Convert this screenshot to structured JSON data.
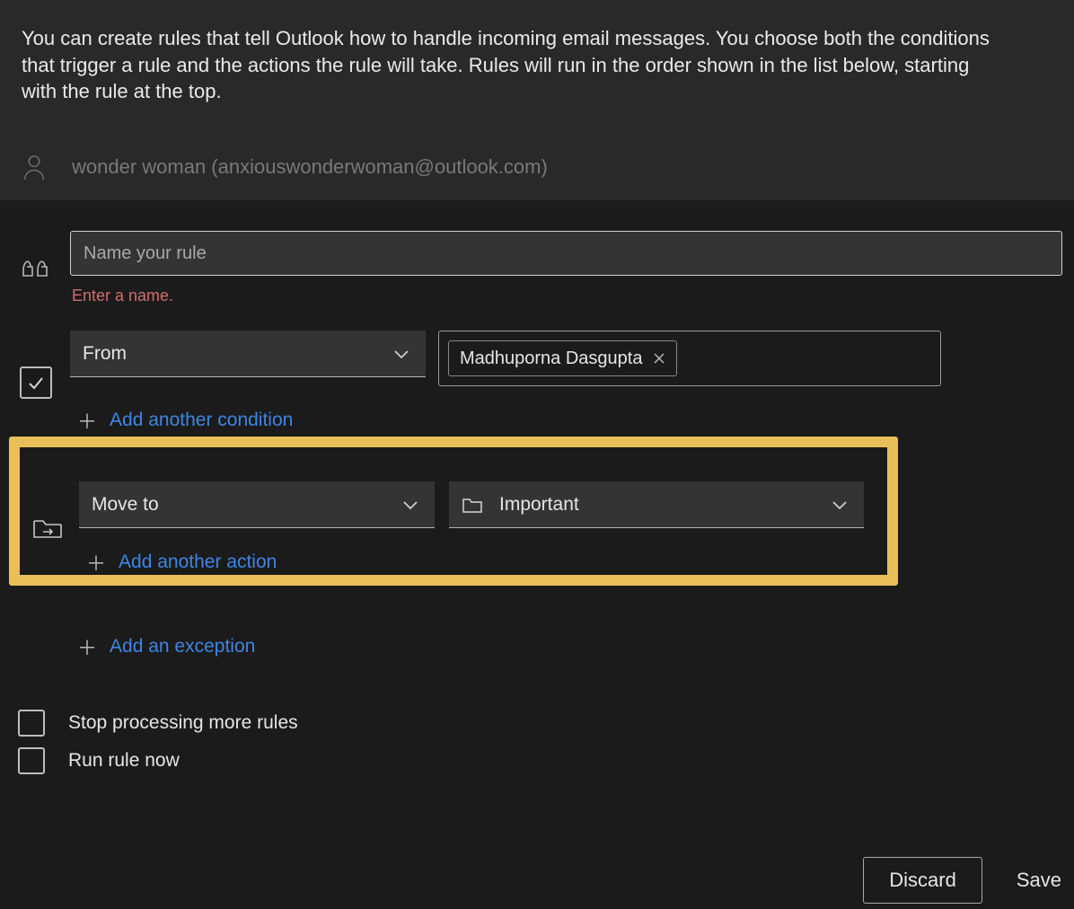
{
  "intro": "You can create rules that tell Outlook how to handle incoming email messages. You choose both the conditions that trigger a rule and the actions the rule will take. Rules will run in the order shown in the list below, starting with the rule at the top.",
  "account": {
    "display": "wonder woman (anxiouswonderwoman@outlook.com)"
  },
  "rule_name": {
    "placeholder": "Name your rule",
    "value": "",
    "error": "Enter a name."
  },
  "condition": {
    "type_label": "From",
    "chip_name": "Madhuporna Dasgupta",
    "add_link": "Add another condition"
  },
  "action": {
    "type_label": "Move to",
    "folder_label": "Important",
    "add_link": "Add another action"
  },
  "exception": {
    "add_link": "Add an exception"
  },
  "options": {
    "stop_processing_label": "Stop processing more rules",
    "stop_processing_checked": false,
    "run_now_label": "Run rule now",
    "run_now_checked": false
  },
  "footer": {
    "discard": "Discard",
    "save": "Save"
  }
}
